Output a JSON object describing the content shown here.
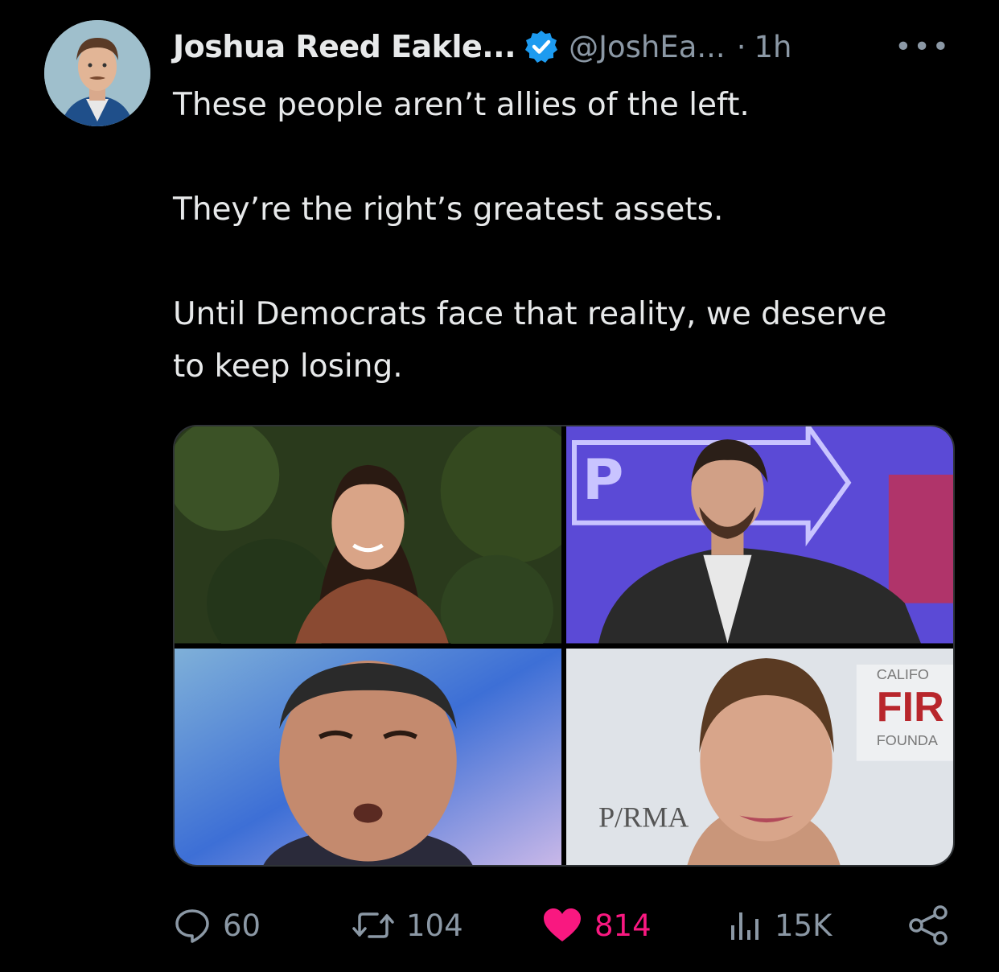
{
  "tweet": {
    "author_name": "Joshua Reed Eakle...",
    "handle": "@JoshEa...",
    "separator": "·",
    "time": "1h",
    "more_label": "•••",
    "text": [
      "These people aren’t allies of the left.",
      "They’re the right’s greatest assets.",
      "Until Democrats face that reality, we deserve to keep losing."
    ],
    "media": [
      {
        "label": "woman-with-dark-hair-outdoors"
      },
      {
        "label": "man-in-suit-on-stage",
        "sign_text": "P"
      },
      {
        "label": "man-close-up-blue-background"
      },
      {
        "label": "woman-at-event-backdrop",
        "backdrop_text_1": "CALIFO",
        "backdrop_text_2": "FIR",
        "backdrop_text_3": "FOUNDA",
        "backdrop_text_4": "P/RMA"
      }
    ],
    "actions": {
      "replies": "60",
      "retweets": "104",
      "likes": "814",
      "views": "15K"
    },
    "colors": {
      "background": "#000000",
      "text": "#e7e9ea",
      "muted": "#8b98a5",
      "verified": "#1d9bf0",
      "like": "#f91880"
    }
  }
}
